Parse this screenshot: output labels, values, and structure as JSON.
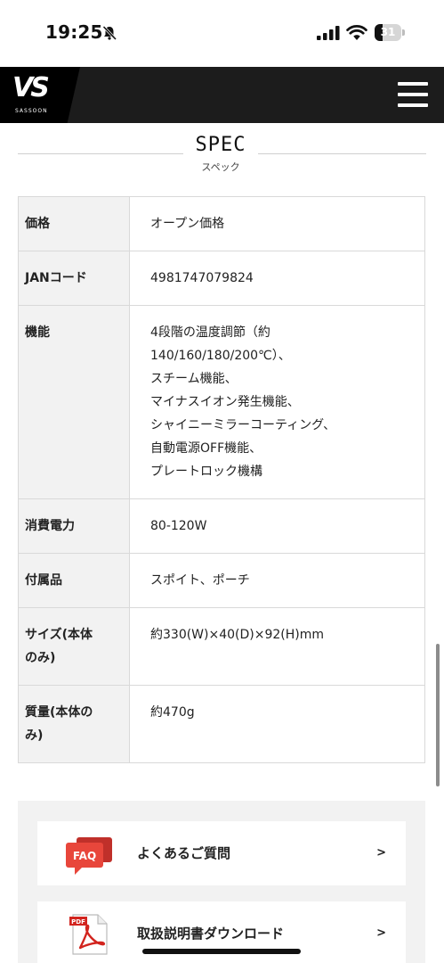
{
  "status_bar": {
    "time": "19:25",
    "battery_percent": 31,
    "battery_label": "31"
  },
  "header": {
    "logo_text": "VS",
    "logo_sub": "SASSOON",
    "menu_icon": "hamburger-menu-icon"
  },
  "spec": {
    "title": "SPEC",
    "subtitle": "スペック",
    "rows": [
      {
        "label": "価格",
        "value": [
          "オープン価格"
        ]
      },
      {
        "label": "JANコード",
        "value": [
          "4981747079824"
        ]
      },
      {
        "label": "機能",
        "value": [
          "4段階の温度調節（約",
          "140/160/180/200℃）、",
          "スチーム機能、",
          "マイナスイオン発生機能、",
          "シャイニーミラーコーティング、",
          "自動電源OFF機能、",
          "プレートロック機構"
        ]
      },
      {
        "label": "消費電力",
        "value": [
          "80-120W"
        ]
      },
      {
        "label": "付属品",
        "value": [
          "スポイト、ポーチ"
        ]
      },
      {
        "label": [
          "サイズ(本体",
          "のみ)"
        ],
        "value": [
          "約330(W)×40(D)×92(H)mm"
        ]
      },
      {
        "label": [
          "質量(本体の",
          "み)"
        ],
        "value": [
          "約470g"
        ]
      }
    ]
  },
  "links": [
    {
      "label": "よくあるご質問",
      "icon": "faq-icon",
      "icon_text": "FAQ",
      "chevron": ">"
    },
    {
      "label": "取扱説明書ダウンロード",
      "icon": "pdf-icon",
      "icon_text": "PDF",
      "chevron": ">"
    }
  ],
  "colors": {
    "header_bg": "#1c1c1c",
    "faq_red": "#e8463b",
    "pdf_red": "#d2241e",
    "table_label_bg": "#f2f2f2"
  }
}
